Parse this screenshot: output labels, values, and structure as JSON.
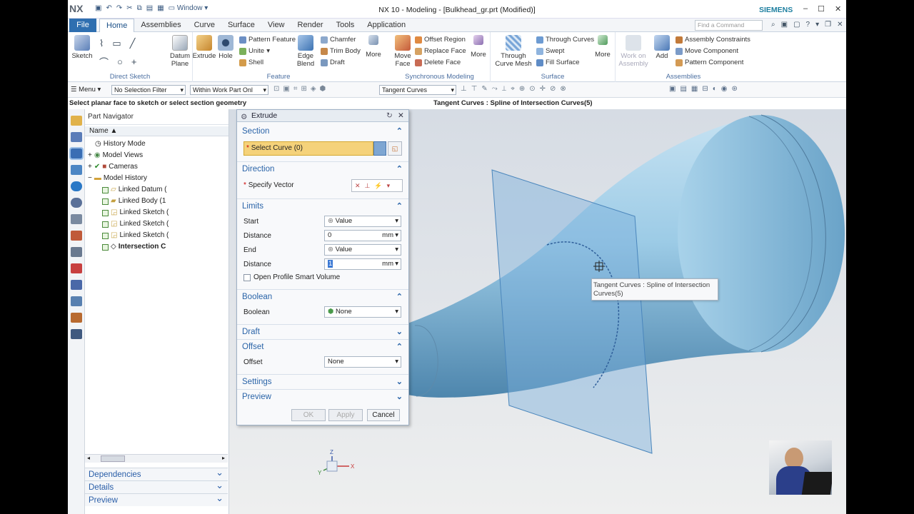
{
  "titlebar": {
    "app_logo": "NX",
    "title": "NX 10 - Modeling - [Bulkhead_gr.prt (Modified)]",
    "brand": "SIEMENS",
    "window_menu": "Window",
    "min": "–",
    "max": "☐",
    "close": "✕"
  },
  "menubar": {
    "file": "File",
    "tabs": [
      "Home",
      "Assemblies",
      "Curve",
      "Surface",
      "View",
      "Render",
      "Tools",
      "Application"
    ],
    "command_finder_placeholder": "Find a Command"
  },
  "ribbon": {
    "direct_sketch": {
      "label": "Direct Sketch",
      "sketch": "Sketch"
    },
    "feature": {
      "label": "Feature",
      "datum_plane": "Datum Plane",
      "extrude": "Extrude",
      "hole": "Hole",
      "pattern_feature": "Pattern Feature",
      "unite": "Unite",
      "shell": "Shell",
      "edge_blend": "Edge Blend",
      "chamfer": "Chamfer",
      "trim_body": "Trim Body",
      "draft": "Draft",
      "more": "More"
    },
    "sync": {
      "label": "Synchronous Modeling",
      "move_face": "Move Face",
      "offset_region": "Offset Region",
      "replace_face": "Replace Face",
      "delete_face": "Delete Face",
      "more": "More"
    },
    "surface": {
      "label": "Surface",
      "through_curve_mesh": "Through Curve Mesh",
      "through_curves": "Through Curves",
      "swept": "Swept",
      "fill_surface": "Fill Surface",
      "more": "More"
    },
    "assemblies": {
      "label": "Assemblies",
      "work_on_assembly": "Work on Assembly",
      "add": "Add",
      "assembly_constraints": "Assembly Constraints",
      "move_component": "Move Component",
      "pattern_component": "Pattern Component"
    }
  },
  "toolbar2": {
    "menu": "Menu",
    "selection_filter": "No Selection Filter",
    "scope": "Within Work Part Onl",
    "curve_rule": "Tangent Curves"
  },
  "cue": {
    "prompt": "Select planar face to sketch or select section geometry",
    "status": "Tangent Curves : Spline of Intersection Curves(5)"
  },
  "navigator": {
    "title": "Part Navigator",
    "column": "Name",
    "items": [
      "History Mode",
      "Model Views",
      "Cameras",
      "Model History",
      "Linked Datum (",
      "Linked Body (1",
      "Linked Sketch (",
      "Linked Sketch (",
      "Linked Sketch (",
      "Intersection C"
    ],
    "panels": [
      "Dependencies",
      "Details",
      "Preview"
    ]
  },
  "dialog": {
    "title": "Extrude",
    "section": "Section",
    "select_curve": "Select Curve (0)",
    "direction": "Direction",
    "specify_vector": "Specify Vector",
    "limits": "Limits",
    "start": "Start",
    "start_value": "Value",
    "distance": "Distance",
    "start_distance": "0",
    "unit": "mm",
    "end": "End",
    "end_value": "Value",
    "end_distance": "1",
    "open_profile": "Open Profile Smart Volume",
    "boolean_section": "Boolean",
    "boolean_label": "Boolean",
    "boolean_value": "None",
    "draft": "Draft",
    "offset_section": "Offset",
    "offset_label": "Offset",
    "offset_value": "None",
    "settings": "Settings",
    "preview": "Preview",
    "ok": "OK",
    "apply": "Apply",
    "cancel": "Cancel"
  },
  "tooltip": {
    "text": "Tangent Curves : Spline of Intersection Curves(5)"
  },
  "triad": {
    "x": "X",
    "y": "Y",
    "z": "Z"
  }
}
